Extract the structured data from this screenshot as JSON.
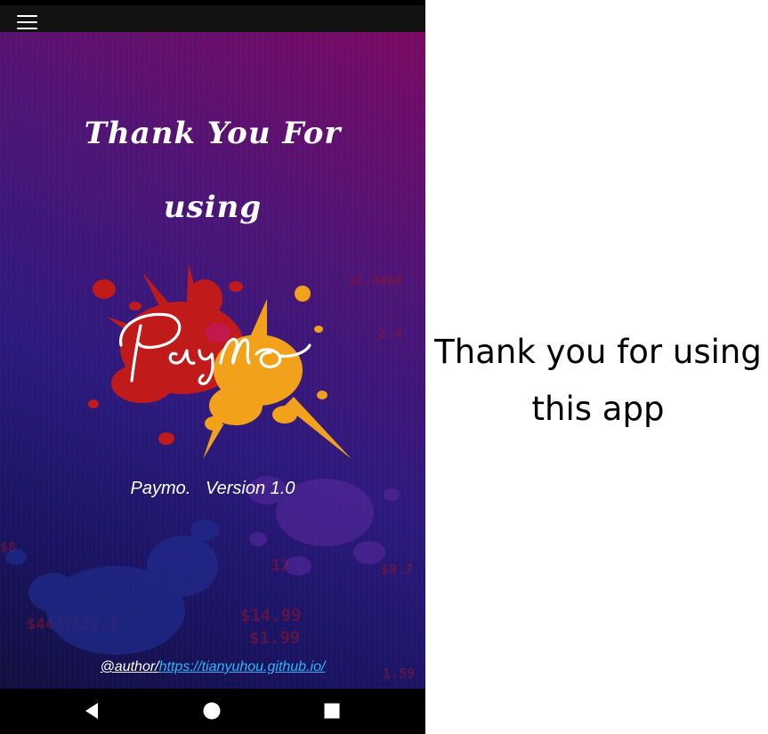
{
  "app_bar": {
    "menu_icon": "hamburger-menu-icon"
  },
  "splash": {
    "title_line1": "Thank You For",
    "title_line2": "using",
    "logo_text": "Paymo",
    "version": "Paymo.   Version 1.0",
    "author_label": "@author/",
    "author_link": "https://tianyuhou.github.io/",
    "background_numbers": [
      "$2.4400",
      "$4477128.3",
      "$14.99",
      "$1.99",
      "12",
      "2.4",
      "$8",
      "$9.7",
      "1.59"
    ],
    "colors": {
      "gradient_top": "#7a0a63",
      "gradient_mid": "#2c1a7c",
      "gradient_bottom": "#120f40",
      "splash_red": "#c01a1a",
      "splash_orange": "#f2a21a",
      "link_blue": "#29b6f6"
    }
  },
  "nav_bar": {
    "back_icon": "back-triangle-icon",
    "home_icon": "home-circle-icon",
    "recents_icon": "recents-square-icon"
  },
  "right_panel": {
    "line1": "Thank you for using",
    "line2": "this app"
  }
}
